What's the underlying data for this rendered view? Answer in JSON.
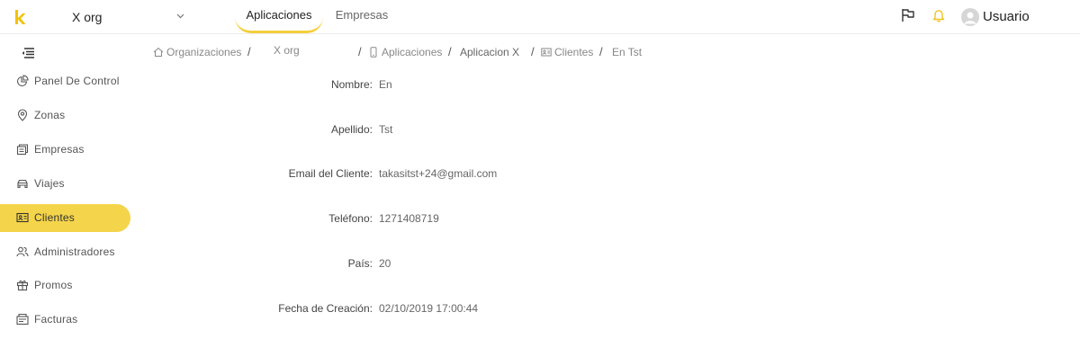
{
  "header": {
    "org_selector": {
      "value": "X org"
    },
    "tabs": [
      {
        "label": "Aplicaciones",
        "active": true
      },
      {
        "label": "Empresas",
        "active": false
      }
    ],
    "icons": [
      "flag-icon",
      "bell-icon"
    ],
    "user": {
      "name": "Usuario"
    }
  },
  "sidebar": {
    "items": [
      {
        "label": "Panel De Control",
        "icon": "pie-chart-icon"
      },
      {
        "label": "Zonas",
        "icon": "map-pin-icon"
      },
      {
        "label": "Empresas",
        "icon": "building-icon"
      },
      {
        "label": "Viajes",
        "icon": "car-icon"
      },
      {
        "label": "Clientes",
        "icon": "id-card-icon",
        "active": true
      },
      {
        "label": "Administradores",
        "icon": "users-icon"
      },
      {
        "label": "Promos",
        "icon": "gift-icon"
      },
      {
        "label": "Facturas",
        "icon": "invoice-icon"
      }
    ]
  },
  "breadcrumb": {
    "items": [
      "Organizaciones",
      "X org",
      "Aplicaciones",
      "Aplicacion X",
      "Clientes",
      "En Tst"
    ],
    "separator": "/"
  },
  "detail": {
    "fields": [
      {
        "label": "Nombre",
        "value": "En"
      },
      {
        "label": "Apellido",
        "value": "Tst"
      },
      {
        "label": "Email del Cliente",
        "value": "takasitst+24@gmail.com"
      },
      {
        "label": "Teléfono",
        "value": "1271408719"
      },
      {
        "label": "País",
        "value": "20"
      },
      {
        "label": "Fecha de Creación",
        "value": "02/10/2019 17:00:44"
      }
    ],
    "colon": ":"
  },
  "colors": {
    "accent": "#f4d44a",
    "logo": "#f2c200",
    "bell": "#f0c419"
  }
}
